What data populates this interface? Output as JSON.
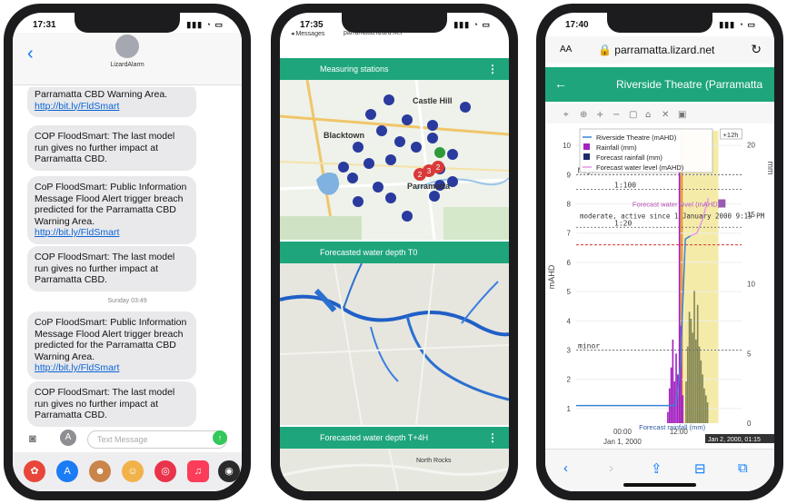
{
  "phone1": {
    "time": "17:31",
    "contact": "LizardAlarm",
    "messages": [
      {
        "text": "Parramatta CBD Warning Area.",
        "link": "http://bit.ly/FldSmart"
      },
      {
        "text": "COP FloodSmart: The last model run gives no further impact at Parramatta CBD.",
        "link": ""
      },
      {
        "text": "CoP FloodSmart: Public Information Message Flood Alert trigger breach predicted for the Parramatta CBD Warning Area.",
        "link": "http://bit.ly/FldSmart"
      },
      {
        "text": "COP FloodSmart: The last model run gives no further impact at Parramatta CBD.",
        "link": ""
      },
      {
        "text": "CoP FloodSmart: Public Information Message Flood Alert trigger breach predicted for the Parramatta CBD Warning Area.",
        "link": "http://bit.ly/FldSmart"
      },
      {
        "text": "COP FloodSmart: The last model run gives no further impact at Parramatta CBD.",
        "link": ""
      }
    ],
    "daystamp": "Sunday 03:49",
    "composer_placeholder": "Text Message"
  },
  "phone2": {
    "time": "17:35",
    "back_label": "◂ Messages",
    "url": "parramatta.lizard.net",
    "panels": [
      {
        "title": "Measuring stations"
      },
      {
        "title": "Forecasted water depth T0"
      },
      {
        "title": "Forecasted water depth T+4H"
      }
    ],
    "map_labels": [
      "Castle Hill",
      "Blacktown",
      "Parramatta",
      "North Rocks"
    ],
    "cluster_badges": [
      "2",
      "3",
      "2"
    ]
  },
  "phone3": {
    "time": "17:40",
    "aa_label": "AA",
    "url": "parramatta.lizard.net",
    "title": "Riverside Theatre (Parramatta",
    "chart_data": {
      "type": "line",
      "title": "",
      "ylabel": "mAHD",
      "y2label": "mm",
      "ylim": [
        0.5,
        10.5
      ],
      "y2lim": [
        0,
        21
      ],
      "y_ticks": [
        "1",
        "2",
        "3",
        "4",
        "5",
        "6",
        "7",
        "8",
        "9",
        "10"
      ],
      "y2_ticks": [
        "0",
        "5",
        "10",
        "15",
        "20"
      ],
      "x_ticks": [
        "00:00",
        "12:00"
      ],
      "x_sublabel": "Jan 1, 2000",
      "legend": [
        "Riverside Theatre (mAHD)",
        "Rainfall (mm)",
        "Forecast rainfall (mm)",
        "Forecast water level (mAHD)"
      ],
      "legend_position": "top-left",
      "thresholds": [
        {
          "label": "Major",
          "value": 9.0
        },
        {
          "label": "1:100",
          "value": 8.5
        },
        {
          "label": "1:20",
          "value": 7.2
        },
        {
          "label": "minor",
          "value": 3.0
        }
      ],
      "alarm_text": "moderate, active since 1 January 2000 9:15 PM",
      "now_label": "+12h",
      "hover_labels": [
        "Forecast water level (mAHD)",
        "Forecast rainfall (mm)",
        "Jan 2, 2000, 01:15"
      ],
      "rainfall_bars": [
        {
          "x": 0.55,
          "v": 0.8
        },
        {
          "x": 0.56,
          "v": 2.5
        },
        {
          "x": 0.57,
          "v": 4.0
        },
        {
          "x": 0.58,
          "v": 6.0
        },
        {
          "x": 0.59,
          "v": 3.0
        },
        {
          "x": 0.6,
          "v": 5.0
        },
        {
          "x": 0.61,
          "v": 3.5
        },
        {
          "x": 0.62,
          "v": 18.5
        },
        {
          "x": 0.63,
          "v": 7.0
        },
        {
          "x": 0.64,
          "v": 2.0
        }
      ],
      "forecast_bars": [
        {
          "x": 0.66,
          "v": 3.0
        },
        {
          "x": 0.67,
          "v": 5.5
        },
        {
          "x": 0.68,
          "v": 8.0
        },
        {
          "x": 0.69,
          "v": 7.5
        },
        {
          "x": 0.7,
          "v": 6.5
        },
        {
          "x": 0.71,
          "v": 9.5
        },
        {
          "x": 0.72,
          "v": 6.0
        },
        {
          "x": 0.73,
          "v": 8.5
        },
        {
          "x": 0.74,
          "v": 5.5
        },
        {
          "x": 0.75,
          "v": 4.5
        },
        {
          "x": 0.76,
          "v": 3.5
        },
        {
          "x": 0.77,
          "v": 2.5
        },
        {
          "x": 0.78,
          "v": 2.0
        },
        {
          "x": 0.79,
          "v": 1.5
        }
      ],
      "water_level": [
        [
          0.0,
          1.1
        ],
        [
          0.6,
          1.1
        ],
        [
          0.61,
          1.4
        ],
        [
          0.63,
          2.5
        ],
        [
          0.66,
          6.8
        ],
        [
          0.69,
          6.9
        ]
      ],
      "forecast_level": [
        [
          0.69,
          6.9
        ],
        [
          0.73,
          7.0
        ],
        [
          0.76,
          7.4
        ],
        [
          0.8,
          8.2
        ]
      ]
    }
  },
  "colors": {
    "teal": "#1ea57c",
    "ios_blue": "#0a7aff",
    "station_dot": "#2a3a9e",
    "rain": "#a321c0",
    "forecast_rain": "#6b7040",
    "forecast_band": "#f3e79a"
  }
}
